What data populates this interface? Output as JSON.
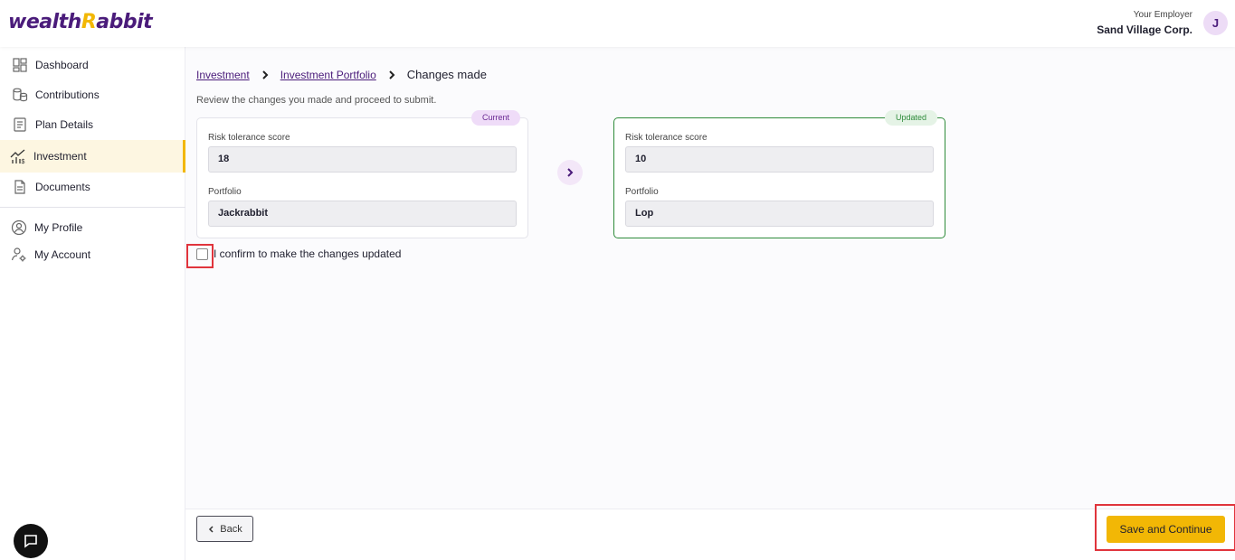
{
  "brand": {
    "logo_pre": "wealth",
    "logo_r": "R",
    "logo_post": "abbit"
  },
  "header": {
    "employer_label": "Your Employer",
    "employer_name": "Sand Village Corp.",
    "avatar_initial": "J"
  },
  "sidebar": {
    "items": [
      {
        "label": "Dashboard",
        "icon": "dashboard-icon"
      },
      {
        "label": "Contributions",
        "icon": "coins-icon"
      },
      {
        "label": "Plan Details",
        "icon": "document-list-icon"
      },
      {
        "label": "Investment",
        "icon": "chart-growth-icon",
        "active": true
      },
      {
        "label": "Documents",
        "icon": "file-icon"
      },
      {
        "label": "My Profile",
        "icon": "user-circle-icon"
      },
      {
        "label": "My Account",
        "icon": "user-settings-icon"
      }
    ]
  },
  "breadcrumb": {
    "items": [
      "Investment",
      "Investment Portfolio"
    ],
    "current": "Changes made"
  },
  "main": {
    "subtitle": "Review the changes you made and proceed to submit.",
    "current": {
      "badge": "Current",
      "risk_label": "Risk tolerance score",
      "risk_value": "18",
      "portfolio_label": "Portfolio",
      "portfolio_value": "Jackrabbit"
    },
    "updated": {
      "badge": "Updated",
      "risk_label": "Risk tolerance score",
      "risk_value": "10",
      "portfolio_label": "Portfolio",
      "portfolio_value": "Lop"
    },
    "confirm_text": "I confirm to make the changes updated",
    "confirm_checked": false
  },
  "footer": {
    "back_label": "Back",
    "save_label": "Save and Continue"
  },
  "colors": {
    "brand_purple": "#4a1b7a",
    "accent_yellow": "#f2b705",
    "updated_green": "#2e8b3a",
    "highlight_red": "#e0343c"
  }
}
